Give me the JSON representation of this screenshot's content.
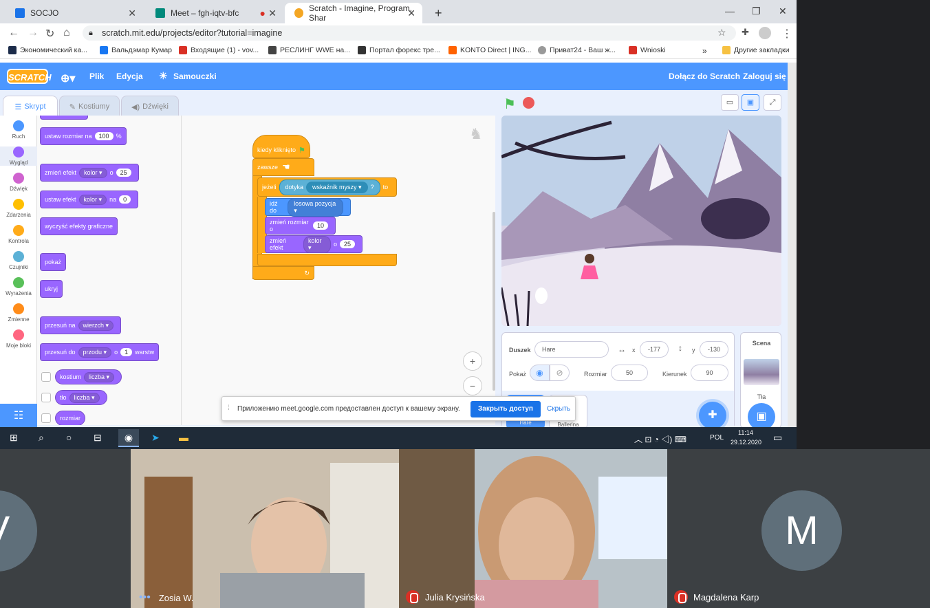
{
  "browser": {
    "tabs": [
      {
        "label": "SOCJO",
        "color": "#1a73e8"
      },
      {
        "label": "Meet – fgh-iqtv-bfc",
        "color": "#00897b"
      },
      {
        "label": "Scratch - Imagine, Program, Shar",
        "color": "#f4a623"
      }
    ],
    "new_tab": "+",
    "url": "scratch.mit.edu/projects/editor?tutorial=imagine",
    "bookmarks": [
      {
        "label": "Экономический ка...",
        "color": "#1c2c4a"
      },
      {
        "label": "Вальдэмар Кумар",
        "color": "#1877f2"
      },
      {
        "label": "Входящие (1) - vov...",
        "color": "#d93025"
      },
      {
        "label": "РЕСЛИНГ WWE на...",
        "color": "#444"
      },
      {
        "label": "Портал форекс тре...",
        "color": "#333"
      },
      {
        "label": "KONTO Direct | ING...",
        "color": "#ff6200"
      },
      {
        "label": "Приват24 - Ваш ж...",
        "color": "#999"
      },
      {
        "label": "Wnioski",
        "color": "#d93025"
      }
    ],
    "more": "»",
    "other_bookmarks": "Другие закладки"
  },
  "scratch": {
    "logo": "SCRATCH",
    "menu": {
      "file": "Plik",
      "edit": "Edycja",
      "tutorials": "Samouczki",
      "join": "Dołącz do Scratch",
      "login": "Zaloguj się"
    },
    "tabs": {
      "code": "Skrypt",
      "costumes": "Kostiumy",
      "sounds": "Dźwięki"
    },
    "categories": [
      {
        "label": "Ruch",
        "color": "#4c97ff"
      },
      {
        "label": "Wygląd",
        "color": "#9966ff"
      },
      {
        "label": "Dźwięk",
        "color": "#cf63cf"
      },
      {
        "label": "Zdarzenia",
        "color": "#ffbf00"
      },
      {
        "label": "Kontrola",
        "color": "#ffab19"
      },
      {
        "label": "Czujniki",
        "color": "#5cb1d6"
      },
      {
        "label": "Wyrażenia",
        "color": "#59c059"
      },
      {
        "label": "Zmienne",
        "color": "#ff8c1a"
      },
      {
        "label": "Moje bloki",
        "color": "#ff6680"
      }
    ],
    "palette": {
      "set_size": "ustaw rozmiar na",
      "set_size_val": "100",
      "percent": "%",
      "change_effect": "zmień efekt",
      "effect_opt": "kolor ▾",
      "by": "o",
      "change_effect_val": "25",
      "set_effect": "ustaw efekt",
      "to": "na",
      "set_effect_val": "0",
      "clear_effects": "wyczyść efekty graficzne",
      "show": "pokaż",
      "hide": "ukryj",
      "go_to": "przesuń na",
      "layer_opt": "wierzch ▾",
      "go_layers": "przesuń do",
      "layer_dir": "przodu ▾",
      "layers_val": "1",
      "layers_word": "warstw",
      "costume": "kostium",
      "number_opt": "liczba ▾",
      "backdrop": "tło",
      "size": "rozmiar"
    },
    "script": {
      "when_flag": "kiedy kliknięto",
      "forever": "zawsze",
      "if": "jeżeli",
      "touching": "dotyka",
      "mouse_ptr": "wskaźnik myszy ▾",
      "q": "?",
      "then": "to",
      "goto": "idź do",
      "random_pos": "losowa pozycja ▾",
      "change_size": "zmień rozmiar o",
      "change_size_val": "10",
      "change_eff": "zmień efekt",
      "eff_opt": "kolor ▾",
      "eff_by": "o",
      "eff_val": "25",
      "repeat_arrow": "↻"
    },
    "zoom_in": "+",
    "zoom_out": "−",
    "sprite_info": {
      "sprite_label": "Duszek",
      "sprite_name": "Hare",
      "x_label": "x",
      "x": "-177",
      "y_label": "y",
      "y": "-130",
      "show_label": "Pokaż",
      "size_label": "Rozmiar",
      "size": "50",
      "direction_label": "Kierunek",
      "direction": "90",
      "sprites": [
        "Hare",
        "Ballerina"
      ]
    },
    "scene": {
      "label": "Scena",
      "backdrops": "Tła"
    }
  },
  "notification": {
    "text": "Приложению meet.google.com предоставлен доступ к вашему экрану.",
    "stop": "Закрыть доступ",
    "hide": "Скрыть"
  },
  "taskbar": {
    "lang": "POL",
    "time": "11:14",
    "date": "29.12.2020"
  },
  "meet": {
    "participants": [
      {
        "name": "Zosia W.",
        "muted": false
      },
      {
        "name": "Julia Krysińska",
        "muted": true
      },
      {
        "name": "Magdalena Karp",
        "muted": true,
        "initial": "M"
      }
    ],
    "left_initial": "V"
  }
}
